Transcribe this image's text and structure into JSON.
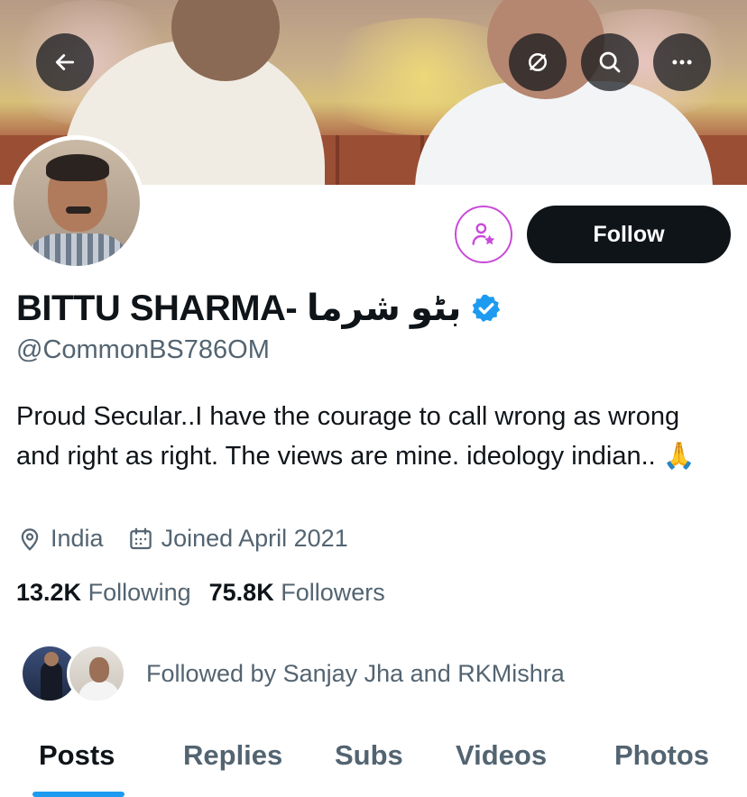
{
  "header": {
    "back_icon": "arrow-left-icon",
    "grok_icon": "grok-icon",
    "search_icon": "search-icon",
    "more_icon": "more-horizontal-icon"
  },
  "profile": {
    "display_name": "BITTU SHARMA- بٹو شرما",
    "verified": true,
    "handle": "@CommonBS786OM",
    "bio": "Proud Secular..I have the courage to call wrong as wrong and right as right. The views are mine. ideology indian.. 🙏",
    "location": "India",
    "joined": "Joined April 2021"
  },
  "actions": {
    "subscribe_icon": "subscribe-star-icon",
    "follow_label": "Follow"
  },
  "stats": {
    "following_count": "13.2K",
    "following_label": "Following",
    "followers_count": "75.8K",
    "followers_label": "Followers"
  },
  "followed_by": "Followed by Sanjay Jha and RKMishra",
  "tabs": [
    {
      "label": "Posts",
      "active": true
    },
    {
      "label": "Replies",
      "active": false
    },
    {
      "label": "Subs",
      "active": false
    },
    {
      "label": "Videos",
      "active": false
    },
    {
      "label": "Photos",
      "active": false
    }
  ],
  "colors": {
    "accent": "#1d9bf0",
    "subscribe": "#c94ad9",
    "follow_bg": "#0f1419",
    "secondary_text": "#536471"
  }
}
